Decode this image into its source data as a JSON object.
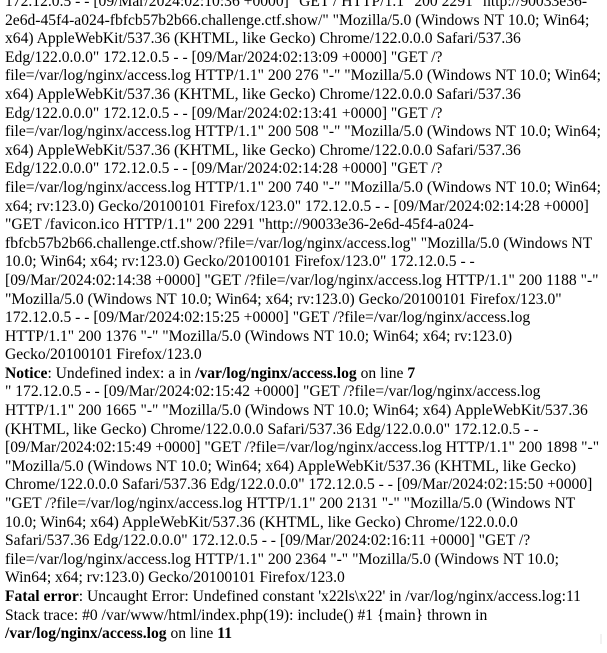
{
  "log_block_1": "172.12.0.5 - - [09/Mar/2024:02:10:36 +0000] \"GET / HTTP/1.1\" 200 2291 \"http://90033e36-2e6d-45f4-a024-fbfcb57b2b66.challenge.ctf.show/\" \"Mozilla/5.0 (Windows NT 10.0; Win64; x64) AppleWebKit/537.36 (KHTML, like Gecko) Chrome/122.0.0.0 Safari/537.36 Edg/122.0.0.0\" 172.12.0.5 - - [09/Mar/2024:02:13:09 +0000] \"GET /?file=/var/log/nginx/access.log HTTP/1.1\" 200 276 \"-\" \"Mozilla/5.0 (Windows NT 10.0; Win64; x64) AppleWebKit/537.36 (KHTML, like Gecko) Chrome/122.0.0.0 Safari/537.36 Edg/122.0.0.0\" 172.12.0.5 - - [09/Mar/2024:02:13:41 +0000] \"GET /?file=/var/log/nginx/access.log HTTP/1.1\" 200 508 \"-\" \"Mozilla/5.0 (Windows NT 10.0; Win64; x64) AppleWebKit/537.36 (KHTML, like Gecko) Chrome/122.0.0.0 Safari/537.36 Edg/122.0.0.0\" 172.12.0.5 - - [09/Mar/2024:02:14:28 +0000] \"GET /?file=/var/log/nginx/access.log HTTP/1.1\" 200 740 \"-\" \"Mozilla/5.0 (Windows NT 10.0; Win64; x64; rv:123.0) Gecko/20100101 Firefox/123.0\" 172.12.0.5 - - [09/Mar/2024:02:14:28 +0000] \"GET /favicon.ico HTTP/1.1\" 200 2291 \"http://90033e36-2e6d-45f4-a024-fbfcb57b2b66.challenge.ctf.show/?file=/var/log/nginx/access.log\" \"Mozilla/5.0 (Windows NT 10.0; Win64; x64; rv:123.0) Gecko/20100101 Firefox/123.0\" 172.12.0.5 - - [09/Mar/2024:02:14:38 +0000] \"GET /?file=/var/log/nginx/access.log HTTP/1.1\" 200 1188 \"-\" \"Mozilla/5.0 (Windows NT 10.0; Win64; x64; rv:123.0) Gecko/20100101 Firefox/123.0\" 172.12.0.5 - - [09/Mar/2024:02:15:25 +0000] \"GET /?file=/var/log/nginx/access.log HTTP/1.1\" 200 1376 \"-\" \"Mozilla/5.0 (Windows NT 10.0; Win64; x64; rv:123.0) Gecko/20100101 Firefox/123.0",
  "notice": {
    "label": "Notice",
    "message": ": Undefined index: a in ",
    "file": "/var/log/nginx/access.log",
    "on_line": " on line ",
    "line": "7"
  },
  "log_block_2": "\" 172.12.0.5 - - [09/Mar/2024:02:15:42 +0000] \"GET /?file=/var/log/nginx/access.log HTTP/1.1\" 200 1665 \"-\" \"Mozilla/5.0 (Windows NT 10.0; Win64; x64) AppleWebKit/537.36 (KHTML, like Gecko) Chrome/122.0.0.0 Safari/537.36 Edg/122.0.0.0\" 172.12.0.5 - - [09/Mar/2024:02:15:49 +0000] \"GET /?file=/var/log/nginx/access.log HTTP/1.1\" 200 1898 \"-\" \"Mozilla/5.0 (Windows NT 10.0; Win64; x64) AppleWebKit/537.36 (KHTML, like Gecko) Chrome/122.0.0.0 Safari/537.36 Edg/122.0.0.0\" 172.12.0.5 - - [09/Mar/2024:02:15:50 +0000] \"GET /?file=/var/log/nginx/access.log HTTP/1.1\" 200 2131 \"-\" \"Mozilla/5.0 (Windows NT 10.0; Win64; x64) AppleWebKit/537.36 (KHTML, like Gecko) Chrome/122.0.0.0 Safari/537.36 Edg/122.0.0.0\" 172.12.0.5 - - [09/Mar/2024:02:16:11 +0000] \"GET /?file=/var/log/nginx/access.log HTTP/1.1\" 200 2364 \"-\" \"Mozilla/5.0 (Windows NT 10.0; Win64; x64; rv:123.0) Gecko/20100101 Firefox/123.0",
  "fatal": {
    "label": "Fatal error",
    "message": ": Uncaught Error: Undefined constant 'x22ls\\x22' in /var/log/nginx/access.log:11 Stack trace: #0 /var/www/html/index.php(19): include() #1 {main} thrown in ",
    "file": "/var/log/nginx/access.log",
    "on_line": " on line ",
    "line": "11"
  }
}
